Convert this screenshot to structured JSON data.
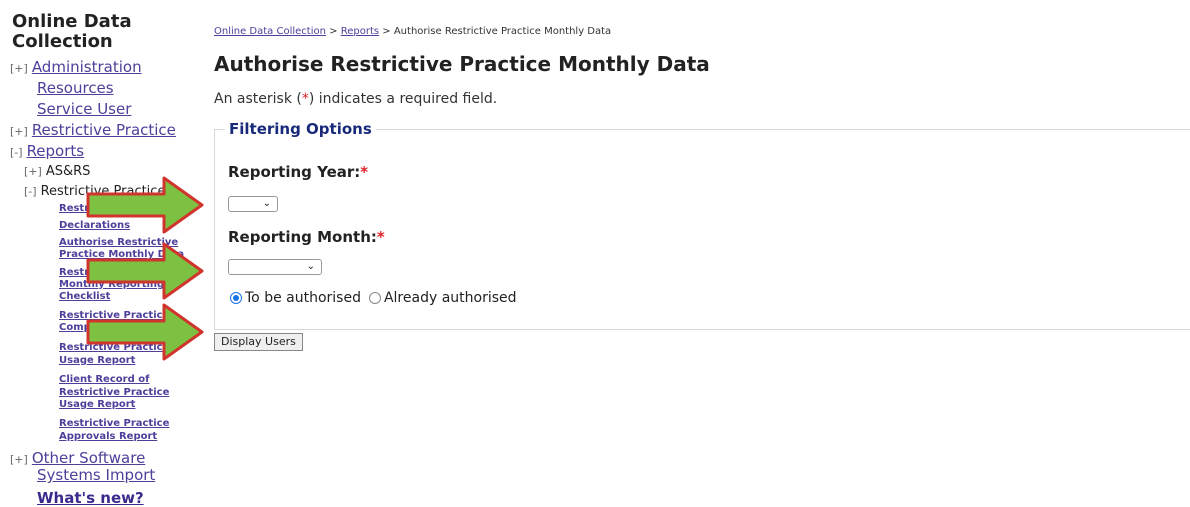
{
  "sidebar": {
    "title": "Online Data Collection",
    "toggle_plus": "[+]",
    "toggle_minus": "[-]",
    "administration": "Administration",
    "resources": "Resources",
    "service_user": "Service User",
    "restrictive_practice": "Restrictive Practice",
    "reports": "Reports",
    "asrs": "AS&RS",
    "restrictive_practice_sub": "Restrictive Practice",
    "sub_items": [
      "Restrictive Practice",
      "Declarations",
      "Authorise Restrictive",
      "Practice Monthly Data",
      "Restrictive Practice",
      "Monthly Reporting",
      "Checklist",
      "Restrictive Practice",
      "Compliance Report",
      "Restrictive Practice",
      "Usage Report",
      "Client Record of",
      "Restrictive Practice",
      "Usage Report",
      "Restrictive Practice",
      "Approvals Report"
    ],
    "other_software": "Other Software",
    "systems_import": "Systems Import",
    "whats_new": "What's new?"
  },
  "breadcrumb": {
    "home": "Online Data Collection",
    "sep": ">",
    "reports": "Reports",
    "current": "Authorise Restrictive Practice Monthly Data"
  },
  "page": {
    "title": "Authorise Restrictive Practice Monthly Data",
    "req_prefix": "An asterisk (",
    "req_star": "*",
    "req_suffix": ") indicates a required field."
  },
  "filter": {
    "legend": "Filtering Options",
    "year_label": "Reporting Year:",
    "month_label": "Reporting Month:",
    "star": "*",
    "chevron": "⌄",
    "year_value": "",
    "month_value": "",
    "radio_to_be": "To be authorised",
    "radio_already": "Already authorised",
    "display_button": "Display Users"
  },
  "colors": {
    "arrow_fill": "#7cc142",
    "arrow_stroke": "#d0342c"
  }
}
